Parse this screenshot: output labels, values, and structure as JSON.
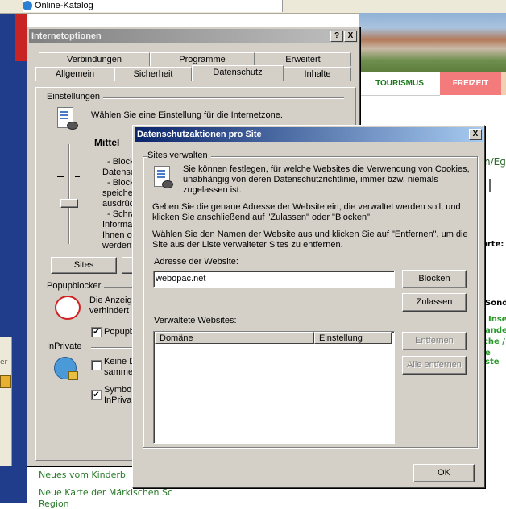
{
  "background": {
    "tab_title": "Online-Katalog",
    "nav_tourism": "TOURISMUS",
    "nav_freizeit": "FREIZEIT",
    "right_fragments": [
      "n/Eg",
      "orte:",
      "Sond",
      "Inse",
      "ande",
      "che /",
      "e ste"
    ],
    "left_fragments": [
      "er"
    ],
    "bottom_links": [
      "Neues vom Kinderb",
      "Neue Karte der Märkischen Sc",
      "Region"
    ]
  },
  "internet_options": {
    "title": "Internetoptionen",
    "help_btn": "?",
    "close_btn": "X",
    "tabs_back": [
      "Verbindungen",
      "Programme",
      "Erweitert"
    ],
    "tabs_front": [
      "Allgemein",
      "Sicherheit",
      "Datenschutz",
      "Inhalte"
    ],
    "settings_group": "Einstellungen",
    "settings_desc": "Wählen Sie eine Einstellung für die Internetzone.",
    "level": "Mittel",
    "level_lines": [
      "- Blockt",
      "Datensc",
      "- Blockt",
      "speiche",
      "ausdrüc",
      "- Schrän",
      "Informa",
      "Ihnen o",
      "werden"
    ],
    "sites_btn": "Sites",
    "popup_group": "Popupblocker",
    "popup_lines": [
      "Die Anzeig",
      "verhindert"
    ],
    "popup_check_label": "Popupb",
    "popup_checked": true,
    "inprivate_group": "InPrivate",
    "inprivate_lines1": [
      "Keine D",
      "samme"
    ],
    "inprivate_lines2": [
      "Symbo",
      "InPriva"
    ],
    "inprivate_check1": false,
    "inprivate_check2": true
  },
  "privacy_actions": {
    "title": "Datenschutzaktionen pro Site",
    "close_btn": "X",
    "group": "Sites verwalten",
    "desc_lines": [
      "Sie können festlegen, für welche Websites die Verwendung von Cookies,",
      "unabhängig von deren Datenschutzrichtlinie, immer bzw. niemals",
      "zugelassen ist."
    ],
    "para2_lines": [
      "Geben Sie die genaue Adresse der Website ein, die verwaltet werden soll, und",
      "klicken Sie anschließend auf \"Zulassen\" oder \"Blocken\"."
    ],
    "para3_lines": [
      "Wählen Sie den Namen der Website aus und klicken Sie auf \"Entfernen\", um die",
      "Site aus der Liste verwalteter Sites zu entfernen."
    ],
    "address_label": "Adresse der Website:",
    "address_value": "webopac.net",
    "block_btn": "Blocken",
    "allow_btn": "Zulassen",
    "managed_label": "Verwaltete Websites:",
    "columns": [
      "Domäne",
      "Einstellung"
    ],
    "rows": [],
    "remove_btn": "Entfernen",
    "remove_all_btn": "Alle entfernen",
    "ok_btn": "OK"
  }
}
